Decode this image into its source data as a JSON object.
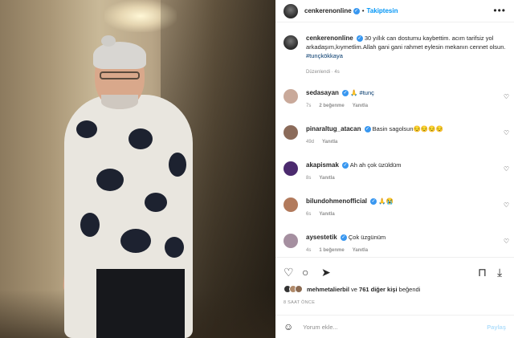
{
  "post": {
    "username": "cenkerenonline",
    "follow_label": "Takiptesin",
    "more_label": "•••"
  },
  "caption": {
    "username": "cenkerenonline",
    "text": "30 yıllık can dostumu kaybettim. acım tarifsiz yol arkadaşım,kıymetlim.Allah gani gani rahmet eylesin mekanın cennet olsun.",
    "hashtag": "#tunçkökkaya",
    "edited": "Düzenlendi · 4s"
  },
  "comments": [
    {
      "username": "sedasayan",
      "text": "🙏 ",
      "hashtag": "#tunç",
      "time": "7s",
      "likes": "2 beğenme",
      "reply": "Yanıtla",
      "avatar_color": "#c9a99a"
    },
    {
      "username": "pinaraltug_atacan",
      "text": "Basin sagolsun😔😔😔😔",
      "hashtag": "",
      "time": "49d",
      "likes": "",
      "reply": "Yanıtla",
      "avatar_color": "#8b6b5a"
    },
    {
      "username": "akapismak",
      "text": "Ah ah çok üzüldüm",
      "hashtag": "",
      "time": "8s",
      "likes": "",
      "reply": "Yanıtla",
      "avatar_color": "#4b2a6e"
    },
    {
      "username": "bilundohmenofficial",
      "text": "🙏😭",
      "hashtag": "",
      "time": "6s",
      "likes": "",
      "reply": "Yanıtla",
      "avatar_color": "#b27a5c"
    },
    {
      "username": "aysestetik",
      "text": "Çok üzgünüm",
      "hashtag": "",
      "time": "4s",
      "likes": "1 beğenme",
      "reply": "Yanıtla",
      "avatar_color": "#a58fa0"
    }
  ],
  "likes": {
    "first_user": "mehmetalierbil",
    "connector": " ve ",
    "others": "761 diğer kişi",
    "suffix": " beğendi"
  },
  "timestamp": "8 SAAT ÖNCE",
  "comment_box": {
    "placeholder": "Yorum ekle...",
    "post_label": "Paylaş"
  },
  "icons": {
    "heart": "♡",
    "comment": "○",
    "share": "➤",
    "bookmark": "⊓",
    "download": "⤓",
    "emoji": "☺",
    "verified": "✓"
  }
}
